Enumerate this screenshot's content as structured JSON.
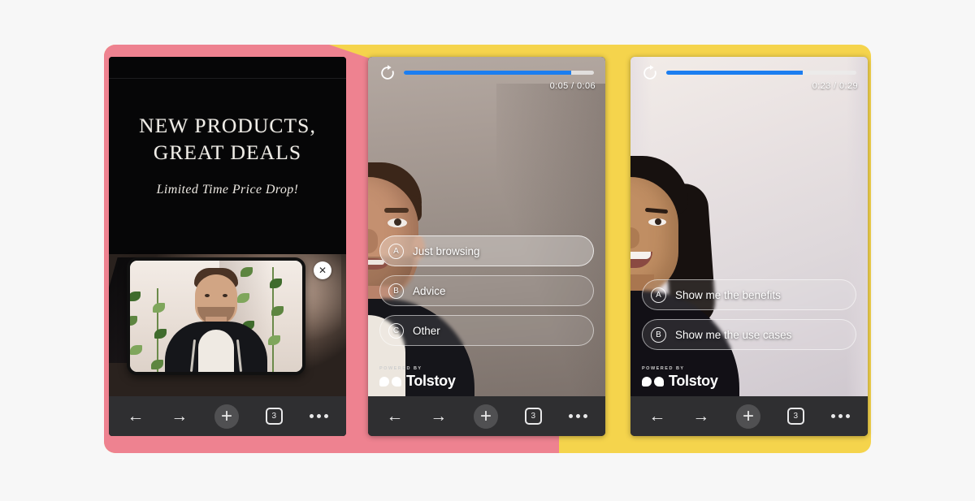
{
  "page": {
    "background_color": "#F7F7F7",
    "accent_pink": "#EE8290",
    "accent_yellow": "#F5D44C",
    "progress_blue": "#1C7EF0"
  },
  "panels": [
    {
      "id": "promo-card",
      "promo": {
        "headline_line1": "NEW PRODUCTS,",
        "headline_line2": "GREAT DEALS",
        "subhead": "Limited Time Price Drop!"
      },
      "pip": {
        "close_glyph": "✕",
        "alt": "presenter-video"
      },
      "nav": {
        "back": "←",
        "forward": "→",
        "new_tab": "+",
        "tab_count": "3",
        "more": "•••"
      }
    },
    {
      "id": "quiz-video-male",
      "player": {
        "replay_icon": "replay-icon",
        "time": "0:05 / 0:06",
        "progress_percent": 88
      },
      "choices": [
        {
          "key": "A",
          "label": "Just browsing",
          "selected": true
        },
        {
          "key": "B",
          "label": "Advice",
          "selected": false
        },
        {
          "key": "C",
          "label": "Other",
          "selected": false
        }
      ],
      "badge": {
        "kicker": "POWERED BY",
        "word": "Tolstoy"
      },
      "nav": {
        "back": "←",
        "forward": "→",
        "new_tab": "+",
        "tab_count": "3",
        "more": "•••"
      }
    },
    {
      "id": "quiz-video-female",
      "player": {
        "replay_icon": "replay-icon",
        "time": "0:23 / 0:29",
        "progress_percent": 72
      },
      "choices": [
        {
          "key": "A",
          "label": "Show me the benefits",
          "selected": false
        },
        {
          "key": "B",
          "label": "Show me the use cases",
          "selected": false
        }
      ],
      "badge": {
        "kicker": "POWERED BY",
        "word": "Tolstoy"
      },
      "nav": {
        "back": "←",
        "forward": "→",
        "new_tab": "+",
        "tab_count": "3",
        "more": "•••"
      }
    }
  ]
}
